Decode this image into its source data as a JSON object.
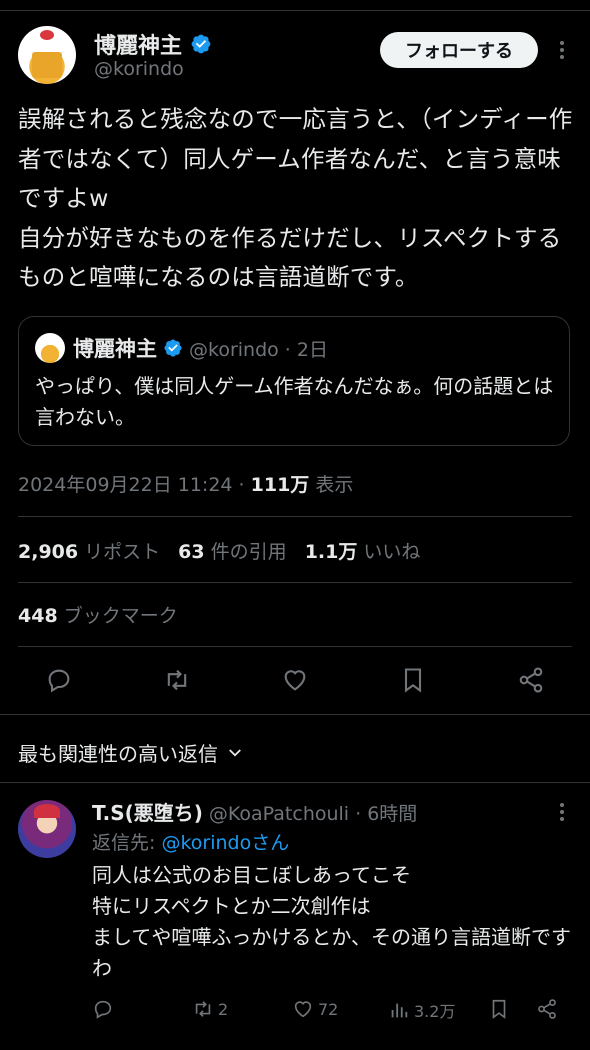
{
  "author": {
    "display_name": "博麗神主",
    "handle": "@korindo"
  },
  "follow_button": "フォローする",
  "tweet": {
    "text": "誤解されると残念なので一応言うと、（インディー作者ではなくて）同人ゲーム作者なんだ、と言う意味ですよw\n自分が好きなものを作るだけだし、リスペクトするものと喧嘩になるのは言語道断です。",
    "timestamp": "2024年09月22日 11:24 · ",
    "views_count": "111万",
    "views_label": " 表示"
  },
  "quote": {
    "display_name": "博麗神主",
    "meta": "@korindo · 2日",
    "text": "やっぱり、僕は同人ゲーム作者なんだなぁ。何の話題とは言わない。"
  },
  "stats": {
    "reposts_count": "2,906",
    "reposts_label": "リポスト",
    "quotes_count": "63",
    "quotes_label": "件の引用",
    "likes_count": "1.1万",
    "likes_label": "いいね",
    "bookmarks_count": "448",
    "bookmarks_label": "ブックマーク"
  },
  "replies_header": "最も関連性の高い返信",
  "reply": {
    "display_name": "T.S(悪堕ち)",
    "meta": "@KoaPatchouli · 6時間",
    "reply_to_label": "返信先: ",
    "reply_to_handle": "@korindoさん",
    "text": "同人は公式のお目こぼしあってこそ\n特にリスペクトとか二次創作は\nましてや喧嘩ふっかけるとか、その通り言語道断ですわ",
    "retweets": "2",
    "likes": "72",
    "views": "3.2万"
  },
  "colors": {
    "background": "#000000",
    "text": "#e7e9ea",
    "secondary": "#71767b",
    "accent": "#1d9bf0",
    "divider": "#2f3336"
  },
  "icons": [
    "verified-badge-icon",
    "more-options-icon",
    "reply-icon",
    "repost-icon",
    "like-icon",
    "bookmark-icon",
    "share-icon",
    "chevron-down-icon",
    "views-icon"
  ]
}
